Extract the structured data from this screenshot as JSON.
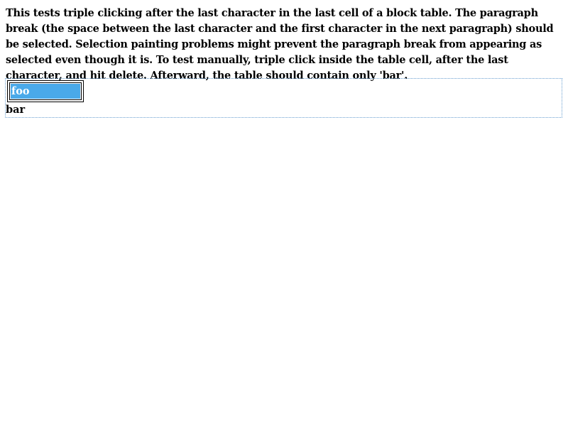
{
  "description": "This tests triple clicking after the last character in the last cell of a block table. The paragraph break (the space between the last character and the first character in the next paragraph) should be selected. Selection painting problems might prevent the paragraph break from appearing as selected even though it is. To test manually, triple click inside the table cell, after the last character, and hit delete. Afterward, the table should contain only 'bar'.",
  "editable": {
    "cell_text": "foo",
    "after_text": "bar"
  },
  "colors": {
    "selection": "#4aa9e9",
    "editable_border": "#6a9fd0"
  }
}
